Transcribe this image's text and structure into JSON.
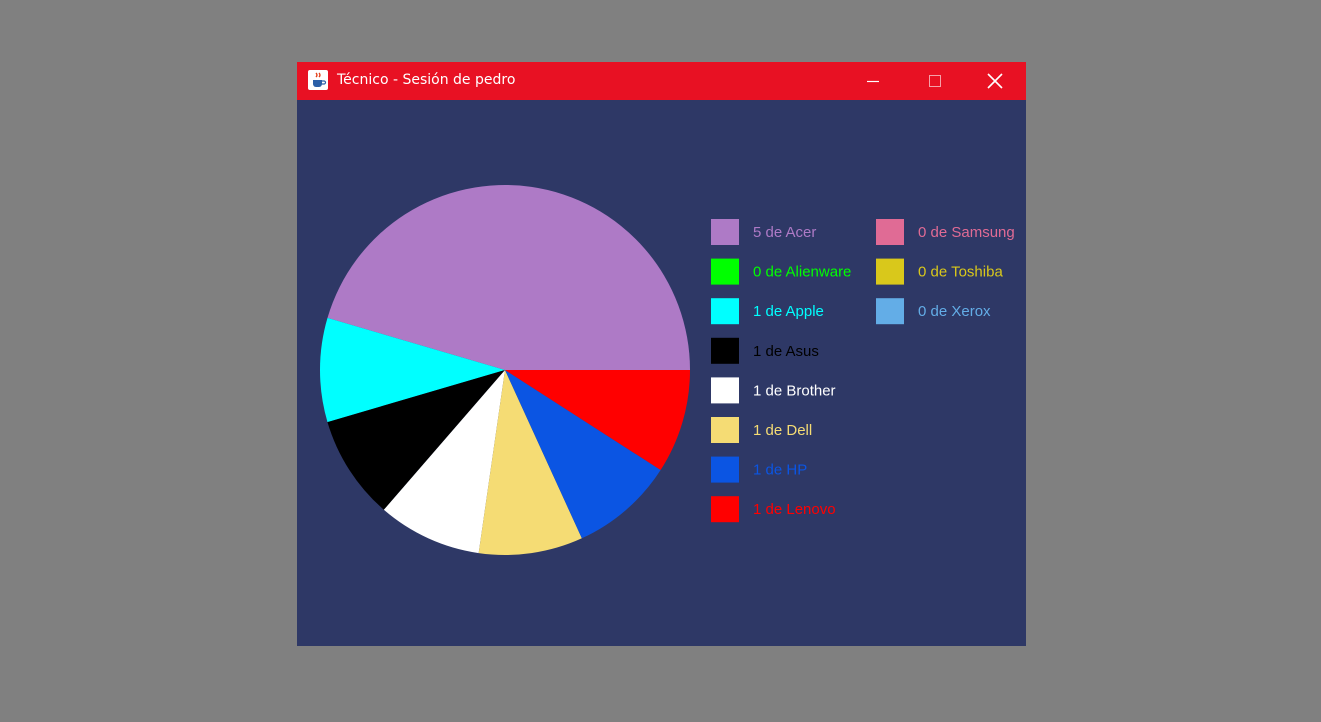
{
  "window": {
    "title": "Técnico - Sesión de pedro",
    "icon": "java-cup-icon",
    "controls": [
      "minimize-icon",
      "maximize-icon",
      "close-icon"
    ]
  },
  "chart_data": {
    "type": "pie",
    "title": "",
    "legend_position": "right",
    "slices": [
      {
        "label": "5 de Acer",
        "value": 5,
        "color": "#ae7ac6"
      },
      {
        "label": "0 de Alienware",
        "value": 0,
        "color": "#00ff00"
      },
      {
        "label": "1 de Apple",
        "value": 1,
        "color": "#00ffff"
      },
      {
        "label": "1 de Asus",
        "value": 1,
        "color": "#000000"
      },
      {
        "label": "1 de Brother",
        "value": 1,
        "color": "#ffffff"
      },
      {
        "label": "1 de Dell",
        "value": 1,
        "color": "#f5dc74"
      },
      {
        "label": "1 de HP",
        "value": 1,
        "color": "#0b55e3"
      },
      {
        "label": "1 de Lenovo",
        "value": 1,
        "color": "#ff0000"
      },
      {
        "label": "0 de Samsung",
        "value": 0,
        "color": "#e06b95"
      },
      {
        "label": "0 de Toshiba",
        "value": 0,
        "color": "#d9c81b"
      },
      {
        "label": "0 de Xerox",
        "value": 0,
        "color": "#63ade7"
      }
    ]
  }
}
